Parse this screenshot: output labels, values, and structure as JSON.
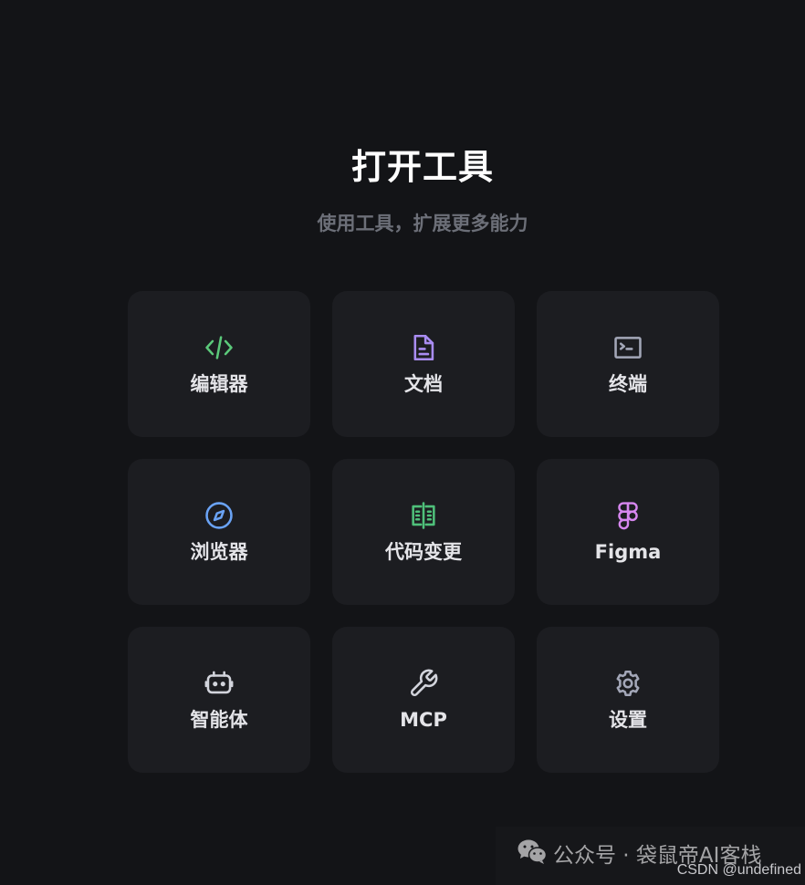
{
  "header": {
    "title": "打开工具",
    "subtitle": "使用工具，扩展更多能力"
  },
  "tools": [
    {
      "label": "编辑器",
      "icon": "code-icon",
      "color": "#5bc97a"
    },
    {
      "label": "文档",
      "icon": "document-icon",
      "color": "#a98cf2"
    },
    {
      "label": "终端",
      "icon": "terminal-icon",
      "color": "#a3a7b8"
    },
    {
      "label": "浏览器",
      "icon": "compass-icon",
      "color": "#6aa3f5"
    },
    {
      "label": "代码变更",
      "icon": "diff-icon",
      "color": "#4fc07a"
    },
    {
      "label": "Figma",
      "icon": "figma-icon",
      "color": "#d787f0"
    },
    {
      "label": "智能体",
      "icon": "robot-icon",
      "color": "#d2d4dc"
    },
    {
      "label": "MCP",
      "icon": "wrench-icon",
      "color": "#d2d4dc"
    },
    {
      "label": "设置",
      "icon": "gear-icon",
      "color": "#a3a7b8"
    }
  ],
  "watermark": {
    "text": "公众号 · 袋鼠帝AI客栈",
    "icon": "wechat-icon"
  },
  "credit": {
    "text": "CSDN @undefined"
  }
}
